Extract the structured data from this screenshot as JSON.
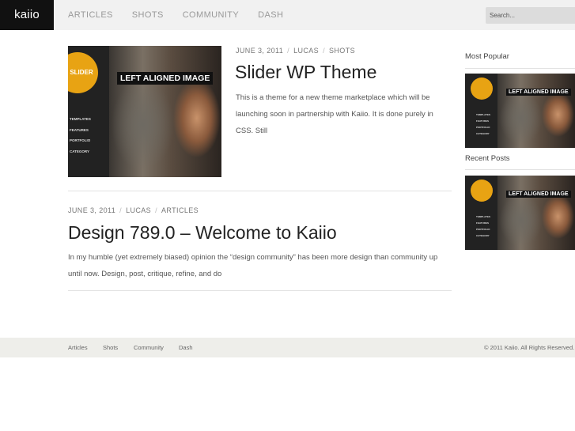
{
  "header": {
    "logo": "kaiio",
    "nav": [
      "ARTICLES",
      "SHOTS",
      "COMMUNITY",
      "DASH"
    ],
    "search_placeholder": "Search..."
  },
  "posts": [
    {
      "date": "JUNE 3, 2011",
      "author": "LUCAS",
      "category": "SHOTS",
      "title": "Slider WP Theme",
      "excerpt": "This is a theme for a new theme marketplace which will be launching soon in partnership with Kaiio. It is done purely in CSS. Still"
    },
    {
      "date": "JUNE 3, 2011",
      "author": "LUCAS",
      "category": "ARTICLES",
      "title": "Design 789.0 – Welcome to Kaiio",
      "excerpt": "In my humble (yet extremely biased) opinion the “design community” has been more design than community up until now. Design, post, critique, refine, and do"
    }
  ],
  "thumbnail": {
    "badge": "SLIDER",
    "caption": "LEFT ALIGNED IMAGE",
    "menu": [
      "TEMPLATES",
      "FEATURES",
      "PORTFOLIO",
      "CATEGORY"
    ],
    "badge_color": "#e8a313"
  },
  "sidebar": {
    "most_popular": "Most Popular",
    "recent_posts": "Recent Posts"
  },
  "footer": {
    "links": [
      "Articles",
      "Shots",
      "Community",
      "Dash"
    ],
    "copyright": "© 2011 Kaiio. All Rights Reserved."
  }
}
